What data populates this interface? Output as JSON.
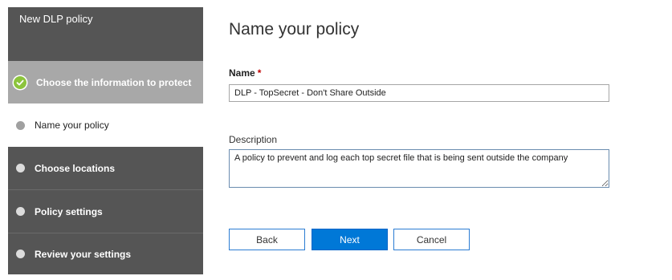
{
  "wizard": {
    "title": "New DLP policy",
    "steps": [
      {
        "label": "Choose the information to protect",
        "state": "completed",
        "icon": "check-icon"
      },
      {
        "label": "Name your policy",
        "state": "current",
        "icon": "dot-icon"
      },
      {
        "label": "Choose locations",
        "state": "pending",
        "icon": "dot-icon"
      },
      {
        "label": "Policy settings",
        "state": "pending",
        "icon": "dot-icon"
      },
      {
        "label": "Review your settings",
        "state": "pending",
        "icon": "dot-icon"
      }
    ]
  },
  "main": {
    "title": "Name your policy",
    "name_label": "Name",
    "required_marker": "*",
    "name_value": "DLP - TopSecret - Don't Share Outside",
    "description_label": "Description",
    "description_value": "A policy to prevent and log each top secret file that is being sent outside the company"
  },
  "buttons": {
    "back": "Back",
    "next": "Next",
    "cancel": "Cancel"
  },
  "colors": {
    "sidebar_bg": "#555555",
    "completed_step_bg": "#a8a8a8",
    "current_step_bg": "#ffffff",
    "check_green": "#8cc43c",
    "primary_blue": "#0078d7",
    "required_red": "#c00000"
  }
}
